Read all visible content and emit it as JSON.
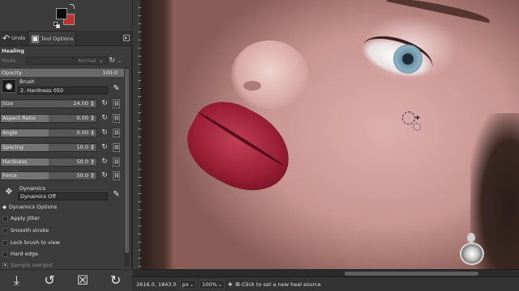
{
  "colors": {
    "foreground": "#0b0b0b",
    "background": "#c1312f"
  },
  "dock_tabs": [
    {
      "label": "Undo",
      "icon": "undo-history-icon",
      "active": false
    },
    {
      "label": "Tool Options",
      "icon": "tool-options-icon",
      "active": true
    }
  ],
  "tool": {
    "title": "Healing",
    "mode_label": "Mode",
    "mode_value": "Normal",
    "opacity_label": "Opacity",
    "opacity_value": "100.0",
    "opacity_fraction": 1.0,
    "brush_label": "Brush",
    "brush_value": "2. Hardness 050",
    "sliders": [
      {
        "label": "Size",
        "value": "24.00",
        "fraction": 0.02
      },
      {
        "label": "Aspect Ratio",
        "value": "0.00",
        "fraction": 0.5
      },
      {
        "label": "Angle",
        "value": "0.00",
        "fraction": 0.5
      },
      {
        "label": "Spacing",
        "value": "10.0",
        "fraction": 0.5
      },
      {
        "label": "Hardness",
        "value": "50.0",
        "fraction": 0.5
      },
      {
        "label": "Force",
        "value": "50.0",
        "fraction": 0.5
      }
    ],
    "dynamics_label": "Dynamics",
    "dynamics_value": "Dynamics Off",
    "dynamics_options_label": "Dynamics Options",
    "checkboxes": [
      {
        "label": "Apply Jitter",
        "checked": false
      },
      {
        "label": "Smooth stroke",
        "checked": false
      },
      {
        "label": "Lock brush to view",
        "checked": false
      },
      {
        "label": "Hard edge",
        "checked": false
      },
      {
        "label": "Sample merged",
        "checked": true
      }
    ]
  },
  "dock_buttons": [
    {
      "icon": "save-preset-icon"
    },
    {
      "icon": "restore-preset-icon"
    },
    {
      "icon": "delete-preset-icon"
    },
    {
      "icon": "reset-defaults-icon"
    }
  ],
  "status": {
    "coordinates": "2616.0, 1843.0",
    "unit": "px",
    "zoom": "100%",
    "hint": "⌘-Click to set a new heal source"
  }
}
